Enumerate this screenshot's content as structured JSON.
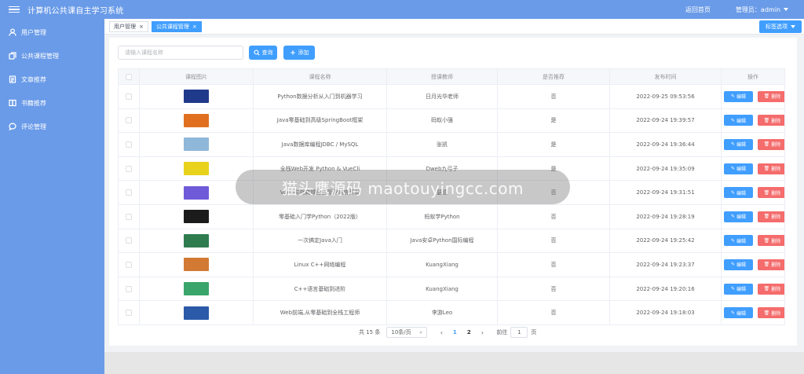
{
  "header": {
    "title": "计算机公共课自主学习系统",
    "home_link": "返回首页",
    "admin_label": "管理员：admin"
  },
  "sidebar": {
    "items": [
      {
        "label": "用户管理",
        "icon": "user-icon"
      },
      {
        "label": "公共课程管理",
        "icon": "copy-icon"
      },
      {
        "label": "文章推荐",
        "icon": "document-icon"
      },
      {
        "label": "书籍推荐",
        "icon": "book-icon"
      },
      {
        "label": "评论管理",
        "icon": "chat-icon"
      }
    ]
  },
  "tabs": [
    {
      "label": "用户管理",
      "active": false
    },
    {
      "label": "公共课程管理",
      "active": true
    }
  ],
  "tag_options_label": "标签选项",
  "toolbar": {
    "search_placeholder": "请输入课程名称",
    "query_label": "查询",
    "add_label": "添加"
  },
  "table": {
    "headers": [
      "课程图片",
      "课程名称",
      "授课教师",
      "是否推荐",
      "发布时间",
      "操作"
    ],
    "rows": [
      {
        "name": "Python数据分析从入门到机器学习",
        "teacher": "日月光华老师",
        "recommended": "否",
        "time": "2022-09-25 09:53:56",
        "thumb_color": "#1f3a8a"
      },
      {
        "name": "Java零基础到高级SpringBoot框架",
        "teacher": "码蚁小强",
        "recommended": "是",
        "time": "2022-09-24 19:39:57",
        "thumb_color": "#e0701f"
      },
      {
        "name": "Java数据库编程JDBC / MySQL",
        "teacher": "张凯",
        "recommended": "是",
        "time": "2022-09-24 19:36:44",
        "thumb_color": "#8fb7d9"
      },
      {
        "name": "全栈Web开发 Python & VueCli",
        "teacher": "Dweb九弓子",
        "recommended": "是",
        "time": "2022-09-24 19:35:09",
        "thumb_color": "#e8d21c"
      },
      {
        "name": "Vue3实战商城后台管理系统开发",
        "teacher": "瑟德",
        "recommended": "否",
        "time": "2022-09-24 19:31:51",
        "thumb_color": "#6f5bd9"
      },
      {
        "name": "零基础入门学Python（2022版）",
        "teacher": "蚂蚁学Python",
        "recommended": "否",
        "time": "2022-09-24 19:28:19",
        "thumb_color": "#1b1b1b"
      },
      {
        "name": "一次搞定Java入门",
        "teacher": "Java安卓Python国际编程",
        "recommended": "否",
        "time": "2022-09-24 19:25:42",
        "thumb_color": "#2f7c4f"
      },
      {
        "name": "Linux C++网络编程",
        "teacher": "KuangXiang",
        "recommended": "否",
        "time": "2022-09-24 19:23:37",
        "thumb_color": "#d27a33"
      },
      {
        "name": "C++语言基础到进阶",
        "teacher": "KuangXiang",
        "recommended": "否",
        "time": "2022-09-24 19:20:16",
        "thumb_color": "#3aa56a"
      },
      {
        "name": "Web前端,从零基础到全栈工程师",
        "teacher": "李游Leo",
        "recommended": "否",
        "time": "2022-09-24 19:18:03",
        "thumb_color": "#2a5aa8"
      }
    ],
    "edit_label": "编辑",
    "delete_label": "删除"
  },
  "pagination": {
    "total_text": "共 15 条",
    "page_size": "10条/页",
    "pages": [
      "1",
      "2"
    ],
    "current_page": "1",
    "goto_label": "前往",
    "goto_value": "1",
    "page_suffix": "页"
  },
  "watermark": "猫头鹰源码 maotouyingcc.com"
}
